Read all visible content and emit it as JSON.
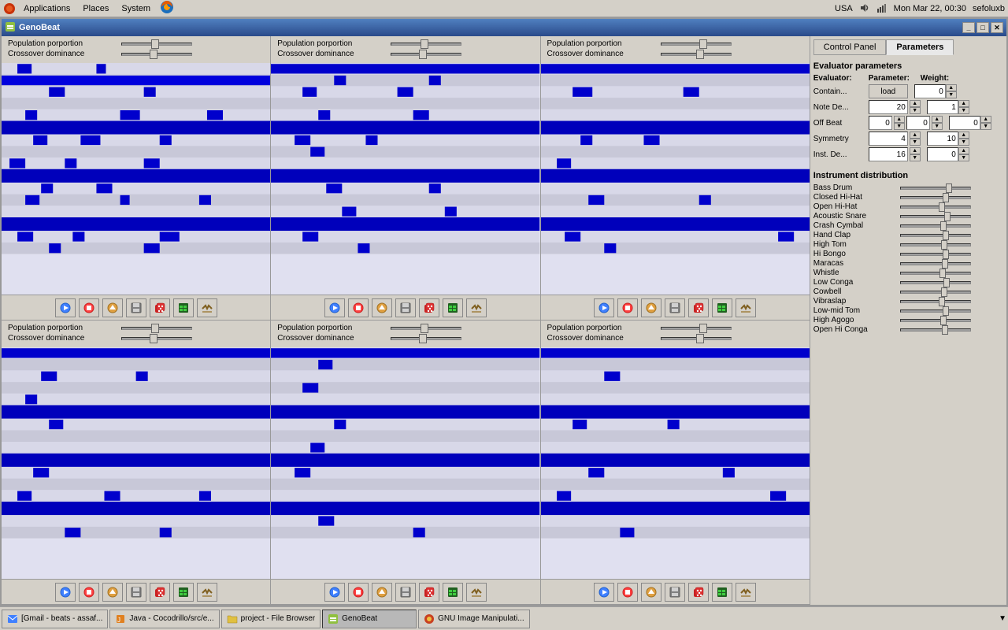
{
  "taskbar_top": {
    "menu_items": [
      "Applications",
      "Places",
      "System"
    ],
    "right_info": {
      "locale": "USA",
      "datetime": "Mon Mar 22, 00:30",
      "user": "sefoluxb"
    }
  },
  "window": {
    "title": "GenoBeat",
    "icon": "genobeat-icon"
  },
  "panels": [
    {
      "id": "panel-1",
      "population_proportion": {
        "label": "Population porportion",
        "value": 50
      },
      "crossover_dominance": {
        "label": "Crossover dominance",
        "value": 45
      }
    },
    {
      "id": "panel-2",
      "population_proportion": {
        "label": "Population porportion",
        "value": 50
      },
      "crossover_dominance": {
        "label": "Crossover dominance",
        "value": 45
      }
    },
    {
      "id": "panel-3",
      "population_proportion": {
        "label": "Population porportion",
        "value": 60
      },
      "crossover_dominance": {
        "label": "Crossover dominance",
        "value": 55
      }
    },
    {
      "id": "panel-4",
      "population_proportion": {
        "label": "Population porportion",
        "value": 50
      },
      "crossover_dominance": {
        "label": "Crossover dominance",
        "value": 45
      }
    },
    {
      "id": "panel-5",
      "population_proportion": {
        "label": "Population porportion",
        "value": 50
      },
      "crossover_dominance": {
        "label": "Crossover dominance",
        "value": 45
      }
    },
    {
      "id": "panel-6",
      "population_proportion": {
        "label": "Population porportion",
        "value": 60
      },
      "crossover_dominance": {
        "label": "Crossover dominance",
        "value": 55
      }
    }
  ],
  "right_panel": {
    "tabs": [
      {
        "id": "control-panel",
        "label": "Control Panel",
        "active": false
      },
      {
        "id": "parameters",
        "label": "Parameters",
        "active": true
      }
    ],
    "evaluator_params": {
      "title": "Evaluator parameters",
      "headers": {
        "evaluator": "Evaluator:",
        "parameter": "Parameter:",
        "weight": "Weight:"
      },
      "rows": [
        {
          "label": "Contain...",
          "parameter_type": "load",
          "parameter_value": "load",
          "weight": "0"
        },
        {
          "label": "Note De...",
          "parameter_value": "20",
          "weight": "1"
        },
        {
          "label": "Off Beat",
          "parameter_value": "0",
          "weight": "0",
          "extra_value": "0"
        },
        {
          "label": "Symmetry",
          "parameter_value": "4",
          "weight": "10"
        },
        {
          "label": "Inst. De...",
          "parameter_value": "16",
          "weight": "0"
        }
      ]
    },
    "instrument_distribution": {
      "title": "Instrument distribution",
      "instruments": [
        {
          "label": "Bass Drum",
          "value": 70
        },
        {
          "label": "Closed Hi-Hat",
          "value": 65
        },
        {
          "label": "Open Hi-Hat",
          "value": 60
        },
        {
          "label": "Acoustic Snare",
          "value": 68
        },
        {
          "label": "Crash Cymbal",
          "value": 62
        },
        {
          "label": "Hand Clap",
          "value": 65
        },
        {
          "label": "High Tom",
          "value": 63
        },
        {
          "label": "Hi Bongo",
          "value": 66
        },
        {
          "label": "Maracas",
          "value": 64
        },
        {
          "label": "Whistle",
          "value": 61
        },
        {
          "label": "Low Conga",
          "value": 67
        },
        {
          "label": "Cowbell",
          "value": 63
        },
        {
          "label": "Vibraslap",
          "value": 60
        },
        {
          "label": "Low-mid Tom",
          "value": 65
        },
        {
          "label": "High Agogo",
          "value": 62
        },
        {
          "label": "Open Hi Conga",
          "value": 64
        }
      ]
    }
  },
  "taskbar_bottom": {
    "items": [
      {
        "label": "[Gmail - beats - assaf...",
        "icon": "email-icon"
      },
      {
        "label": "Java - Cocodrillo/src/e...",
        "icon": "java-icon"
      },
      {
        "label": "project - File Browser",
        "icon": "folder-icon"
      },
      {
        "label": "GenoBeat",
        "icon": "genobeat-icon",
        "active": true
      },
      {
        "label": "GNU Image Manipulati...",
        "icon": "gimp-icon"
      }
    ]
  }
}
